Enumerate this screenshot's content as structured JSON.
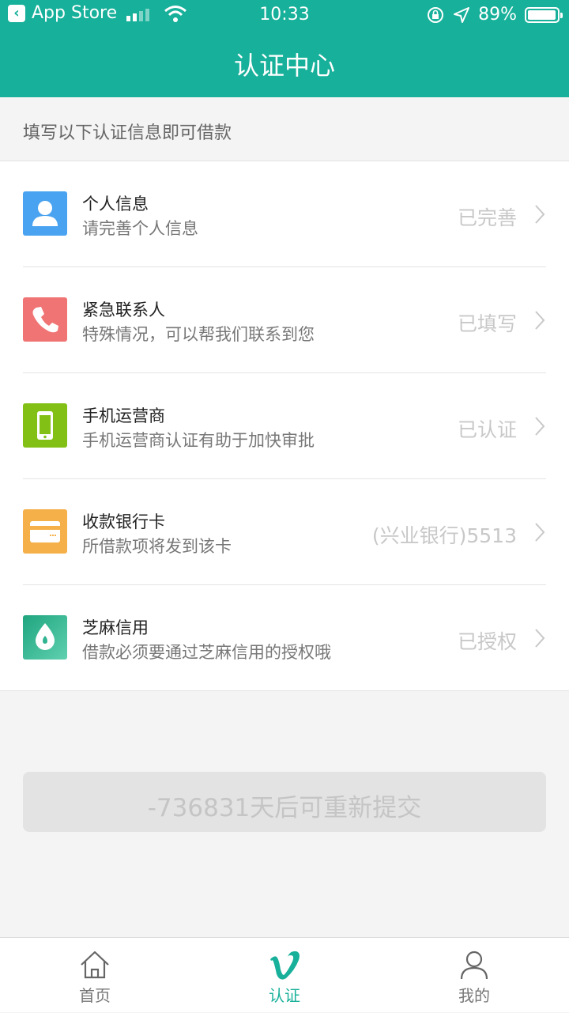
{
  "status_bar": {
    "back_app": "App Store",
    "time": "10:33",
    "battery": "89%"
  },
  "header": {
    "title": "认证中心"
  },
  "subhead": {
    "text": "填写以下认证信息即可借款"
  },
  "items": [
    {
      "title": "个人信息",
      "subtitle": "请完善个人信息",
      "status": "已完善",
      "icon": "person-icon",
      "color": "#4aa3f0"
    },
    {
      "title": "紧急联系人",
      "subtitle": "特殊情况，可以帮我们联系到您",
      "status": "已填写",
      "icon": "phone-icon",
      "color": "#f07474"
    },
    {
      "title": "手机运营商",
      "subtitle": "手机运营商认证有助于加快审批",
      "status": "已认证",
      "icon": "mobile-icon",
      "color": "#82c016"
    },
    {
      "title": "收款银行卡",
      "subtitle": "所借款项将发到该卡",
      "status": "(兴业银行)5513",
      "icon": "bank-card-icon",
      "color": "#f5b04a"
    },
    {
      "title": "芝麻信用",
      "subtitle": "借款必须要通过芝麻信用的授权哦",
      "status": "已授权",
      "icon": "sesame-icon",
      "color": "#2fb390"
    }
  ],
  "submit": {
    "label": "-736831天后可重新提交"
  },
  "tabs": [
    {
      "label": "首页",
      "icon": "home-icon",
      "active": false
    },
    {
      "label": "认证",
      "icon": "vimeo-v-icon",
      "active": true
    },
    {
      "label": "我的",
      "icon": "user-icon",
      "active": false
    }
  ],
  "colors": {
    "accent": "#17b09a",
    "background": "#f4f4f4"
  }
}
